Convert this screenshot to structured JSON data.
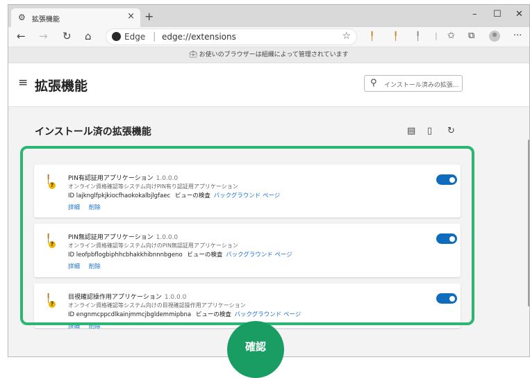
{
  "browser": {
    "tab_title": "拡張機能",
    "tab_close": "×",
    "new_tab": "+",
    "edge_label": "Edge",
    "url": "edge://extensions",
    "managed_notice": "お使いのブラウザーは組織によって管理されています"
  },
  "page": {
    "title": "拡張機能",
    "search_placeholder": "インストール済みの拡張...",
    "section_title": "インストール済の拡張機能"
  },
  "common": {
    "id_prefix": "ID",
    "inspect_label": "ビューの検査",
    "background_page": "バックグラウンド ページ",
    "details": "詳細",
    "remove": "削除"
  },
  "extensions": [
    {
      "name": "PIN有認証用アプリケーション",
      "version": "1.0.0.0",
      "description": "オンライン資格確認等システム向けPIN有り認証用アプリケーション",
      "id": "lajknglfpkjkiocfhaokokalbjlgfaec",
      "enabled": true
    },
    {
      "name": "PIN無認証用アプリケーション",
      "version": "1.0.0.0",
      "description": "オンライン資格確認等システム向けのPIN無認証用アプリケーション",
      "id": "leofpbflogbiphhcbhakkhibnnnbgeno",
      "enabled": true
    },
    {
      "name": "目視確認操作用アプリケーション",
      "version": "1.0.0.0",
      "description": "オンライン資格確認等システム向けの目視確認操作用アプリケーション",
      "id": "engnmcppcdlkainjmmcjbgldemmipbna",
      "enabled": true
    }
  ],
  "callout": {
    "label": "確認",
    "color": "#1a9d63",
    "frame_color": "#2bb673"
  },
  "colors": {
    "toggle_on": "#0f6cbd",
    "link": "#1a6fd1"
  }
}
